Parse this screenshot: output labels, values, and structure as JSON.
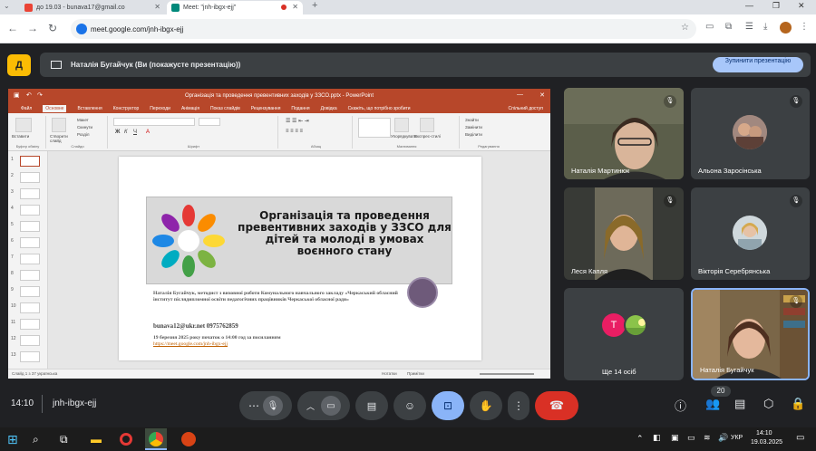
{
  "browser": {
    "tabs": [
      {
        "title": "до 19.03 - bunava17@gmail.co",
        "active": false
      },
      {
        "title": "Meet: \"jnh-ibgx-ejj\"",
        "active": true
      }
    ],
    "new_tab": "+",
    "url": "meet.google.com/jnh-ibgx-ejj"
  },
  "meet": {
    "presenting_text": "Наталія Бугайчук (Ви (покажусте презентацію))",
    "stop_button": "Зупинити презентацію",
    "time": "14:10",
    "meeting_code": "jnh-ibgx-ejj",
    "participants_badge": "20",
    "colors": {
      "end_call": "#d93025",
      "active_btn": "#8ab4f8",
      "stop_btn": "#a8c7fa"
    }
  },
  "ppt": {
    "window_title": "Організація та проведення превентивних заходів у ЗЗСО.pptx - PowerPoint",
    "menu": [
      "Файл",
      "Основне",
      "Вставлення",
      "Конструктор",
      "Переходи",
      "Анімація",
      "Показ слайдів",
      "Рецензування",
      "Подання",
      "Довідка",
      "Скажіть, що потрібно зробити",
      "Спільний доступ"
    ],
    "ribbon_groups": [
      "Буфер обміну",
      "Слайди",
      "Шрифт",
      "Абзац",
      "Малювання",
      "Редагування"
    ],
    "ribbon_buttons": [
      "Вставити",
      "Створити слайд",
      "Макет",
      "Скинути",
      "Розділ",
      "Упорядкувати",
      "Експрес-стилі",
      "Знайти",
      "Замінити",
      "Виділити"
    ],
    "slide_numbers": [
      "1",
      "2",
      "3",
      "4",
      "5",
      "6",
      "7",
      "8",
      "9",
      "10",
      "11",
      "12",
      "13"
    ],
    "status_left": "Слайд 1 з 37   українська",
    "status_notes": "Нотатки",
    "status_comments": "Примітки",
    "slide": {
      "title": "Організація та проведення превентивних заходів у ЗЗСО для дітей та молоді в умовах воєнного стану",
      "author": "Наталія Бугайчук, методист з виховної роботи Комунального навчального закладу «Черкаський обласний інститут післядипломної освіти педагогічних працівників Черкаської обласної ради»",
      "contact": "bunava12@ukr.net  0975762859",
      "meeting": "19 березня 2025 року початок о 14:00 год за посиланням",
      "link": "https://meet.google.com/jnh-ibgx-ejj"
    }
  },
  "participants": [
    {
      "name": "Наталія Мартинюк"
    },
    {
      "name": "Альона Заросінська"
    },
    {
      "name": "Леся Капля"
    },
    {
      "name": "Вікторія Серебрянська"
    },
    {
      "name": "Ще 14 осіб",
      "initial": "T"
    },
    {
      "name": "Наталія Бугайчук"
    }
  ],
  "taskbar": {
    "lang": "УКР",
    "time": "14:10",
    "date": "19.03.2025"
  }
}
